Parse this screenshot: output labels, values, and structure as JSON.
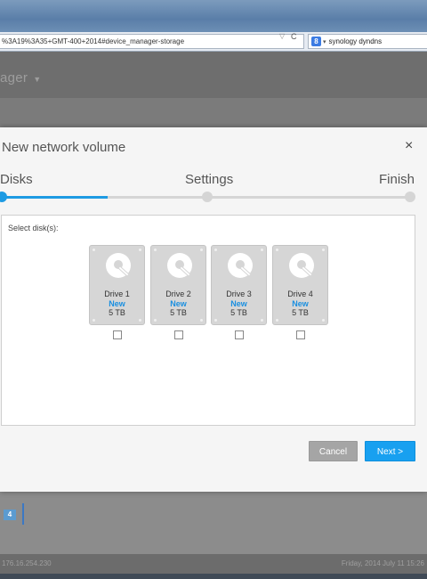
{
  "browser": {
    "url": "%3A19%3A35+GMT-400+2014#device_manager-storage",
    "search_query": "synology dyndns",
    "search_engine_glyph": "8"
  },
  "app": {
    "title": "ager",
    "badge": "4",
    "status_ip": "176.16.254.230",
    "status_datetime": "Friday, 2014 July 11   15:26"
  },
  "modal": {
    "title": "New network volume",
    "close_glyph": "×",
    "steps": [
      {
        "label": "Disks",
        "state": "active"
      },
      {
        "label": "Settings",
        "state": "inactive"
      },
      {
        "label": "Finish",
        "state": "inactive"
      }
    ],
    "progress_fraction": 0.26,
    "select_label": "Select disk(s):",
    "drives": [
      {
        "name": "Drive 1",
        "status": "New",
        "size": "5 TB",
        "checked": false
      },
      {
        "name": "Drive 2",
        "status": "New",
        "size": "5 TB",
        "checked": false
      },
      {
        "name": "Drive 3",
        "status": "New",
        "size": "5 TB",
        "checked": false
      },
      {
        "name": "Drive 4",
        "status": "New",
        "size": "5 TB",
        "checked": false
      }
    ],
    "cancel_label": "Cancel",
    "next_label": "Next >"
  },
  "colors": {
    "accent": "#1e9be3",
    "next_button": "#18a0f0",
    "cancel_button": "#a5a5a5",
    "drive_body": "#d6d6d6"
  }
}
